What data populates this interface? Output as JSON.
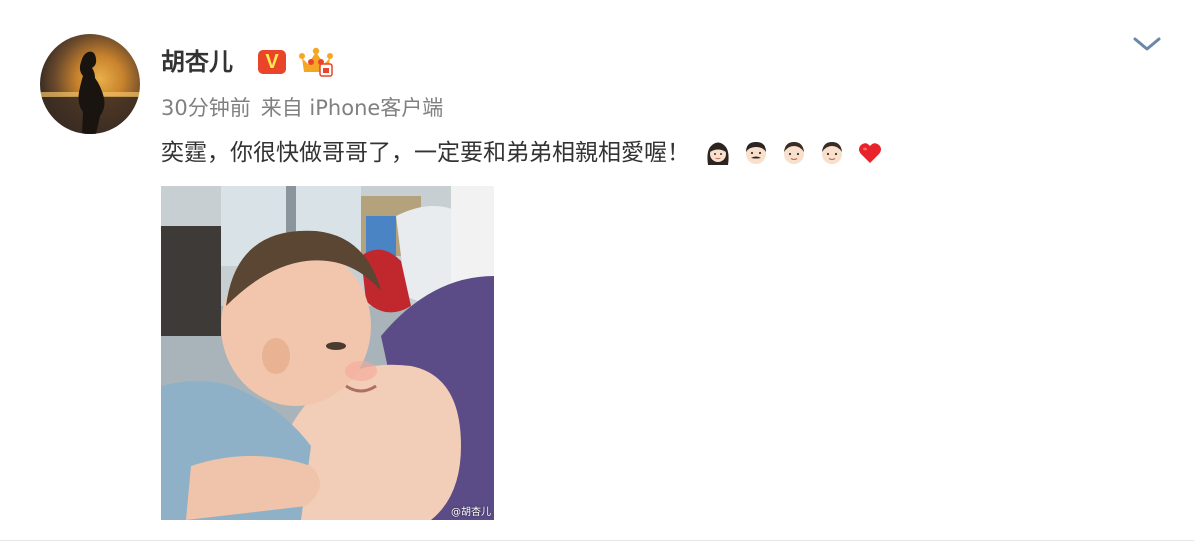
{
  "post": {
    "author": {
      "name": "胡杏儿",
      "verified_badge": "V",
      "avatar_icon": "avatar-silhouette-sunset"
    },
    "meta": {
      "time": "30分钟前",
      "source_prefix": "来自",
      "source": "iPhone客户端"
    },
    "content": {
      "text": "奕霆，你很快做哥哥了，一定要和弟弟相親相愛喔！",
      "emojis": [
        "woman-emoji",
        "man-mustache-emoji",
        "boy-emoji",
        "boy-emoji",
        "red-heart-emoji"
      ]
    },
    "image": {
      "watermark": "@胡杏儿"
    }
  },
  "colors": {
    "accent_red": "#e8452b",
    "badge_yellow": "#ffe94c",
    "muted_text": "#808080",
    "chevron": "#6d87a8"
  }
}
